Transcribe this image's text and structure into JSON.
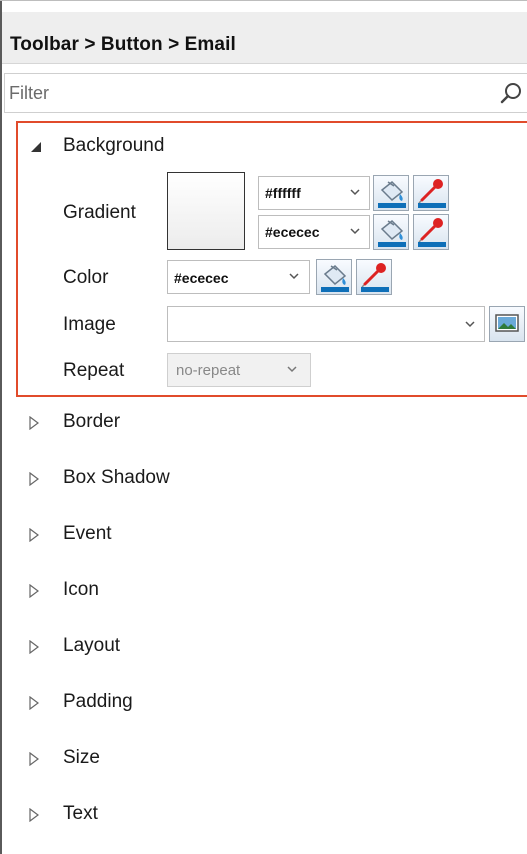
{
  "header": {
    "breadcrumb": "Toolbar > Button > Email"
  },
  "filter": {
    "placeholder": "Filter"
  },
  "background": {
    "title": "Background",
    "gradient_label": "Gradient",
    "gradient_start": "#ffffff",
    "gradient_end": "#ececec",
    "color_label": "Color",
    "color_value": "#ececec",
    "image_label": "Image",
    "image_value": "",
    "repeat_label": "Repeat",
    "repeat_value": "no-repeat"
  },
  "sections": [
    {
      "label": "Border"
    },
    {
      "label": "Box Shadow"
    },
    {
      "label": "Event"
    },
    {
      "label": "Icon"
    },
    {
      "label": "Layout"
    },
    {
      "label": "Padding"
    },
    {
      "label": "Size"
    },
    {
      "label": "Text"
    }
  ],
  "colors": {
    "highlight_border": "#e14b2b",
    "header_bg": "#eeeeee",
    "gradient_start": "#ffffff",
    "gradient_end": "#ececec"
  },
  "icons": {
    "filter": "search-icon",
    "expanded": "triangle-down-icon",
    "collapsed": "triangle-right-icon",
    "fill": "paint-bucket-icon",
    "picker": "eyedropper-icon",
    "image_browse": "image-icon",
    "dropdown": "chevron-down-icon"
  }
}
